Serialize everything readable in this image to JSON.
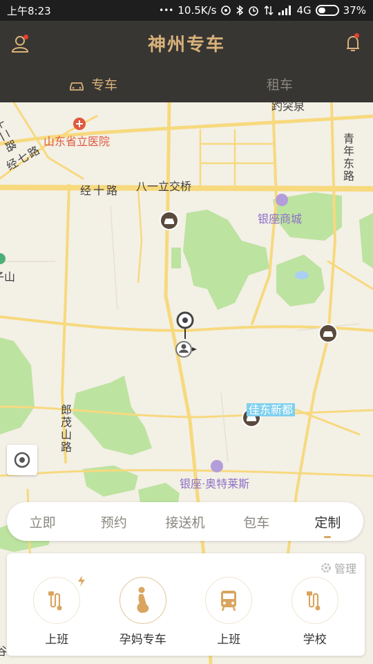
{
  "status_bar": {
    "time": "上午8:23",
    "dots": "•••",
    "speed": "10.5K/s",
    "network": "4G",
    "battery": "37%",
    "battery_level": 0.37
  },
  "header": {
    "title": "神州专车",
    "tabs": [
      {
        "label": "专车",
        "active": true,
        "icon": "car-icon"
      },
      {
        "label": "租车",
        "active": false
      }
    ]
  },
  "map": {
    "labels": {
      "hospital": "山东省立医院",
      "jing_shi_lu": "经十路",
      "bayi_bridge": "八一立交桥",
      "yinzuo_mall": "银座商城",
      "jing_qi_lu": "经七路",
      "wei_shi_er_lu": "纬十二路",
      "qingnian_dong_lu": "青年东路",
      "baotu": "趵突泉",
      "langmao_shan_lu": "郎茂山路",
      "jiadong_xindu": "佳东新都",
      "yinzuo_outlets": "银座·奥特莱斯",
      "shan_partial": "子山",
      "left_bottom": "谷"
    }
  },
  "modes": {
    "items": [
      "立即",
      "预约",
      "接送机",
      "包车",
      "定制"
    ],
    "active_index": 4
  },
  "custom_panel": {
    "manage_label": "管理",
    "options": [
      {
        "label": "上班",
        "icon": "route-icon",
        "badge": "flash-icon"
      },
      {
        "label": "孕妈专车",
        "icon": "pregnant-woman-icon",
        "selected": true
      },
      {
        "label": "上班",
        "icon": "bus-icon"
      },
      {
        "label": "学校",
        "icon": "route-icon"
      }
    ]
  },
  "colors": {
    "accent": "#d9b27a",
    "header_bg": "#383633",
    "park_green": "#bde3a0",
    "road_yellow": "#f7d97e"
  }
}
